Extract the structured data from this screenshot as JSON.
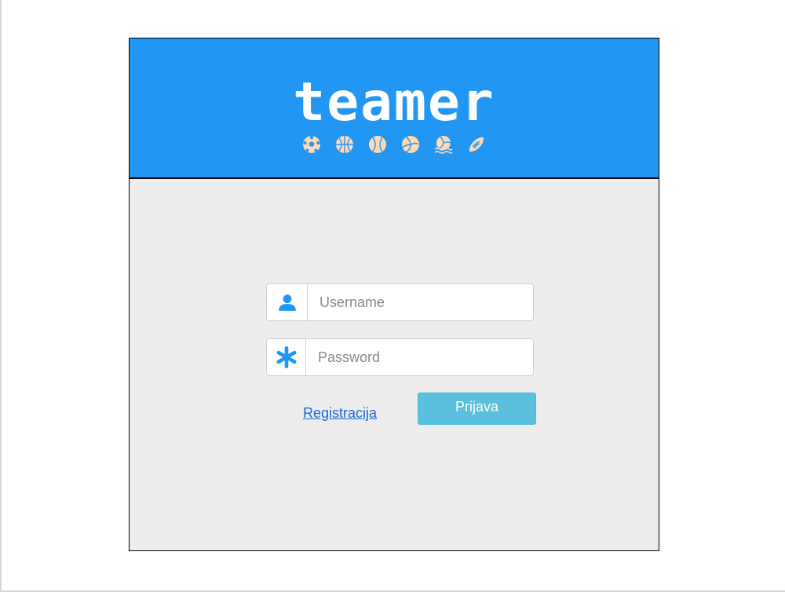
{
  "brand": {
    "name": "teamer",
    "sport_icons": [
      "soccer-ball-icon",
      "basketball-icon",
      "tennis-ball-icon",
      "volleyball-icon",
      "water-polo-icon",
      "american-football-icon"
    ]
  },
  "colors": {
    "banner": "#2196f3",
    "icon": "#ffd9b5",
    "field_icon": "#2196f3",
    "button": "#5bc0de",
    "panel": "#ededed",
    "link": "#1a66d6"
  },
  "form": {
    "username_placeholder": "Username",
    "password_placeholder": "Password",
    "register_link": "Registracija",
    "login_button": "Prijava"
  }
}
